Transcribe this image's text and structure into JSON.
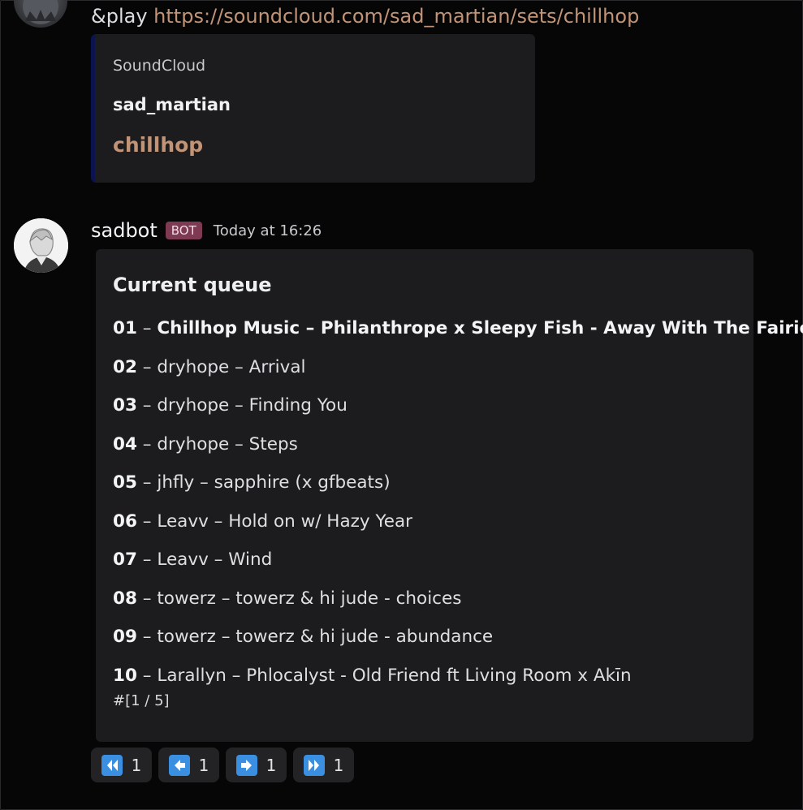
{
  "command_message": {
    "command": "&play",
    "link": "https://soundcloud.com/sad_martian/sets/chillhop",
    "embed": {
      "provider": "SoundCloud",
      "author": "sad_martian",
      "title": "chillhop"
    }
  },
  "bot_message": {
    "username": "sadbot",
    "badge": "BOT",
    "timestamp": "Today at 16:26",
    "embed": {
      "title": "Current queue",
      "separator": "–",
      "tracks": [
        {
          "num": "01",
          "title": "Chillhop Music – Philanthrope x Sleepy Fish - Away With The Fairies",
          "current": true
        },
        {
          "num": "02",
          "title": "dryhope – Arrival"
        },
        {
          "num": "03",
          "title": "dryhope – Finding You"
        },
        {
          "num": "04",
          "title": "dryhope – Steps"
        },
        {
          "num": "05",
          "title": "jhfly – sapphire (x gfbeats)"
        },
        {
          "num": "06",
          "title": "Leavv – Hold on w/ Hazy Year"
        },
        {
          "num": "07",
          "title": "Leavv – Wind"
        },
        {
          "num": "08",
          "title": "towerz – towerz & hi jude - choices"
        },
        {
          "num": "09",
          "title": "towerz – towerz & hi jude - abundance"
        },
        {
          "num": "10",
          "title": "Larallyn – Phlocalyst - Old Friend ft Living Room x Akīn"
        }
      ],
      "footer": "#[1 / 5]"
    },
    "reactions": [
      {
        "icon": "first-page-icon",
        "count": "1"
      },
      {
        "icon": "previous-page-icon",
        "count": "1"
      },
      {
        "icon": "next-page-icon",
        "count": "1"
      },
      {
        "icon": "last-page-icon",
        "count": "1"
      }
    ]
  },
  "colors": {
    "background": "#060606",
    "embed_background": "#1c1c1e",
    "link": "#c19477",
    "embed_accent": "#0b1350",
    "bot_badge": "#7d3a52",
    "reaction_emoji": "#3b8fe0"
  }
}
